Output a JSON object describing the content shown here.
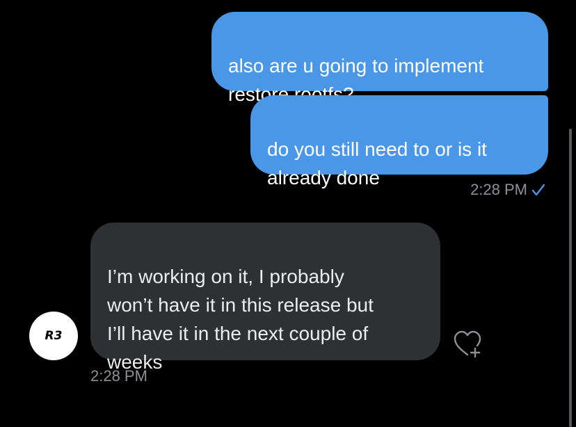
{
  "messages": {
    "sent_1": "also are u going to implement\nrestore rootfs?",
    "sent_2": "do you still need to or is it\nalready done",
    "sent_time": "2:28 PM",
    "received_1": "I’m working on it, I probably\nwon’t have it in this release but\nI’ll have it in the next couple of\nweeks",
    "received_time": "2:28 PM"
  },
  "avatar": {
    "text": "R3"
  },
  "icons": {
    "read_receipt": "checkmark-icon",
    "react": "heart-plus-icon"
  },
  "colors": {
    "background": "#000000",
    "sent_bubble": "#4a97e8",
    "received_bubble": "#2f3033",
    "timestamp": "#8f9094"
  }
}
